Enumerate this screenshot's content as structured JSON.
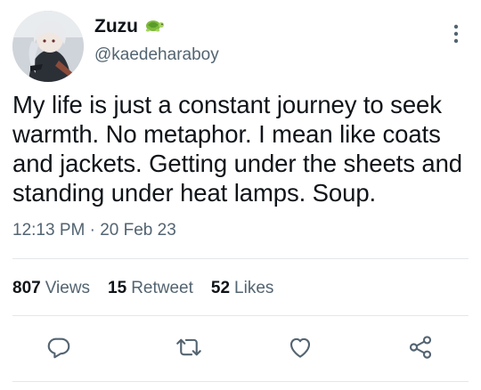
{
  "user": {
    "display_name": "Zuzu",
    "handle": "@kaedeharaboy",
    "badge_icon": "turtle-icon",
    "avatar_icon": "avatar-anime-figure"
  },
  "tweet": {
    "text": "My life is just a constant journey to seek warmth. No metaphor. I mean like coats and jackets. Getting under the sheets and standing under heat lamps. Soup.",
    "time": "12:13 PM",
    "separator": "·",
    "date": "20 Feb 23"
  },
  "stats": {
    "views_count": "807",
    "views_label": "Views",
    "retweets_count": "15",
    "retweets_label": "Retweet",
    "likes_count": "52",
    "likes_label": "Likes"
  },
  "actions": [
    "reply-icon",
    "retweet-icon",
    "like-icon",
    "share-icon"
  ],
  "colors": {
    "text_primary": "#0f1419",
    "text_secondary": "#536471",
    "divider": "#e4e7ea",
    "turtle_green": "#7dbb3c"
  }
}
